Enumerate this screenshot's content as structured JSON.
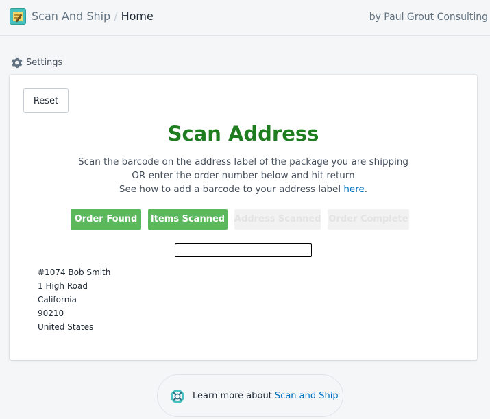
{
  "header": {
    "app_name": "Scan And Ship",
    "separator": "/",
    "page_name": "Home",
    "byline": "by Paul Grout Consulting"
  },
  "settings": {
    "icon": "gear-icon",
    "label": "Settings"
  },
  "card": {
    "reset_label": "Reset",
    "title": "Scan Address",
    "instruction_line1": "Scan the barcode on the address label of the package you are shipping",
    "instruction_line2": "OR enter the order number below and hit return",
    "instruction_line3_prefix": "See how to add a barcode to your address label ",
    "instruction_link": "here",
    "instruction_line3_suffix": ".",
    "steps": [
      {
        "label": "Order Found",
        "status": "done"
      },
      {
        "label": "Items Scanned",
        "status": "done"
      },
      {
        "label": "Address Scanned",
        "status": "pending"
      },
      {
        "label": "Order Complete",
        "status": "pending"
      }
    ],
    "scan_input": {
      "value": "",
      "placeholder": ""
    },
    "address": [
      "#1074 Bob Smith",
      "1 High Road",
      "California",
      "90210",
      "United States"
    ]
  },
  "footer": {
    "icon": "lifebuoy-icon",
    "help_prefix": "Learn more about ",
    "help_link": "Scan and Ship"
  },
  "colors": {
    "title_green": "#1e7d1e",
    "step_done": "#5cb85c",
    "step_pending": "#f2f2f2",
    "link_blue": "#006fbb",
    "help_icon_teal": "#47c1bf"
  }
}
